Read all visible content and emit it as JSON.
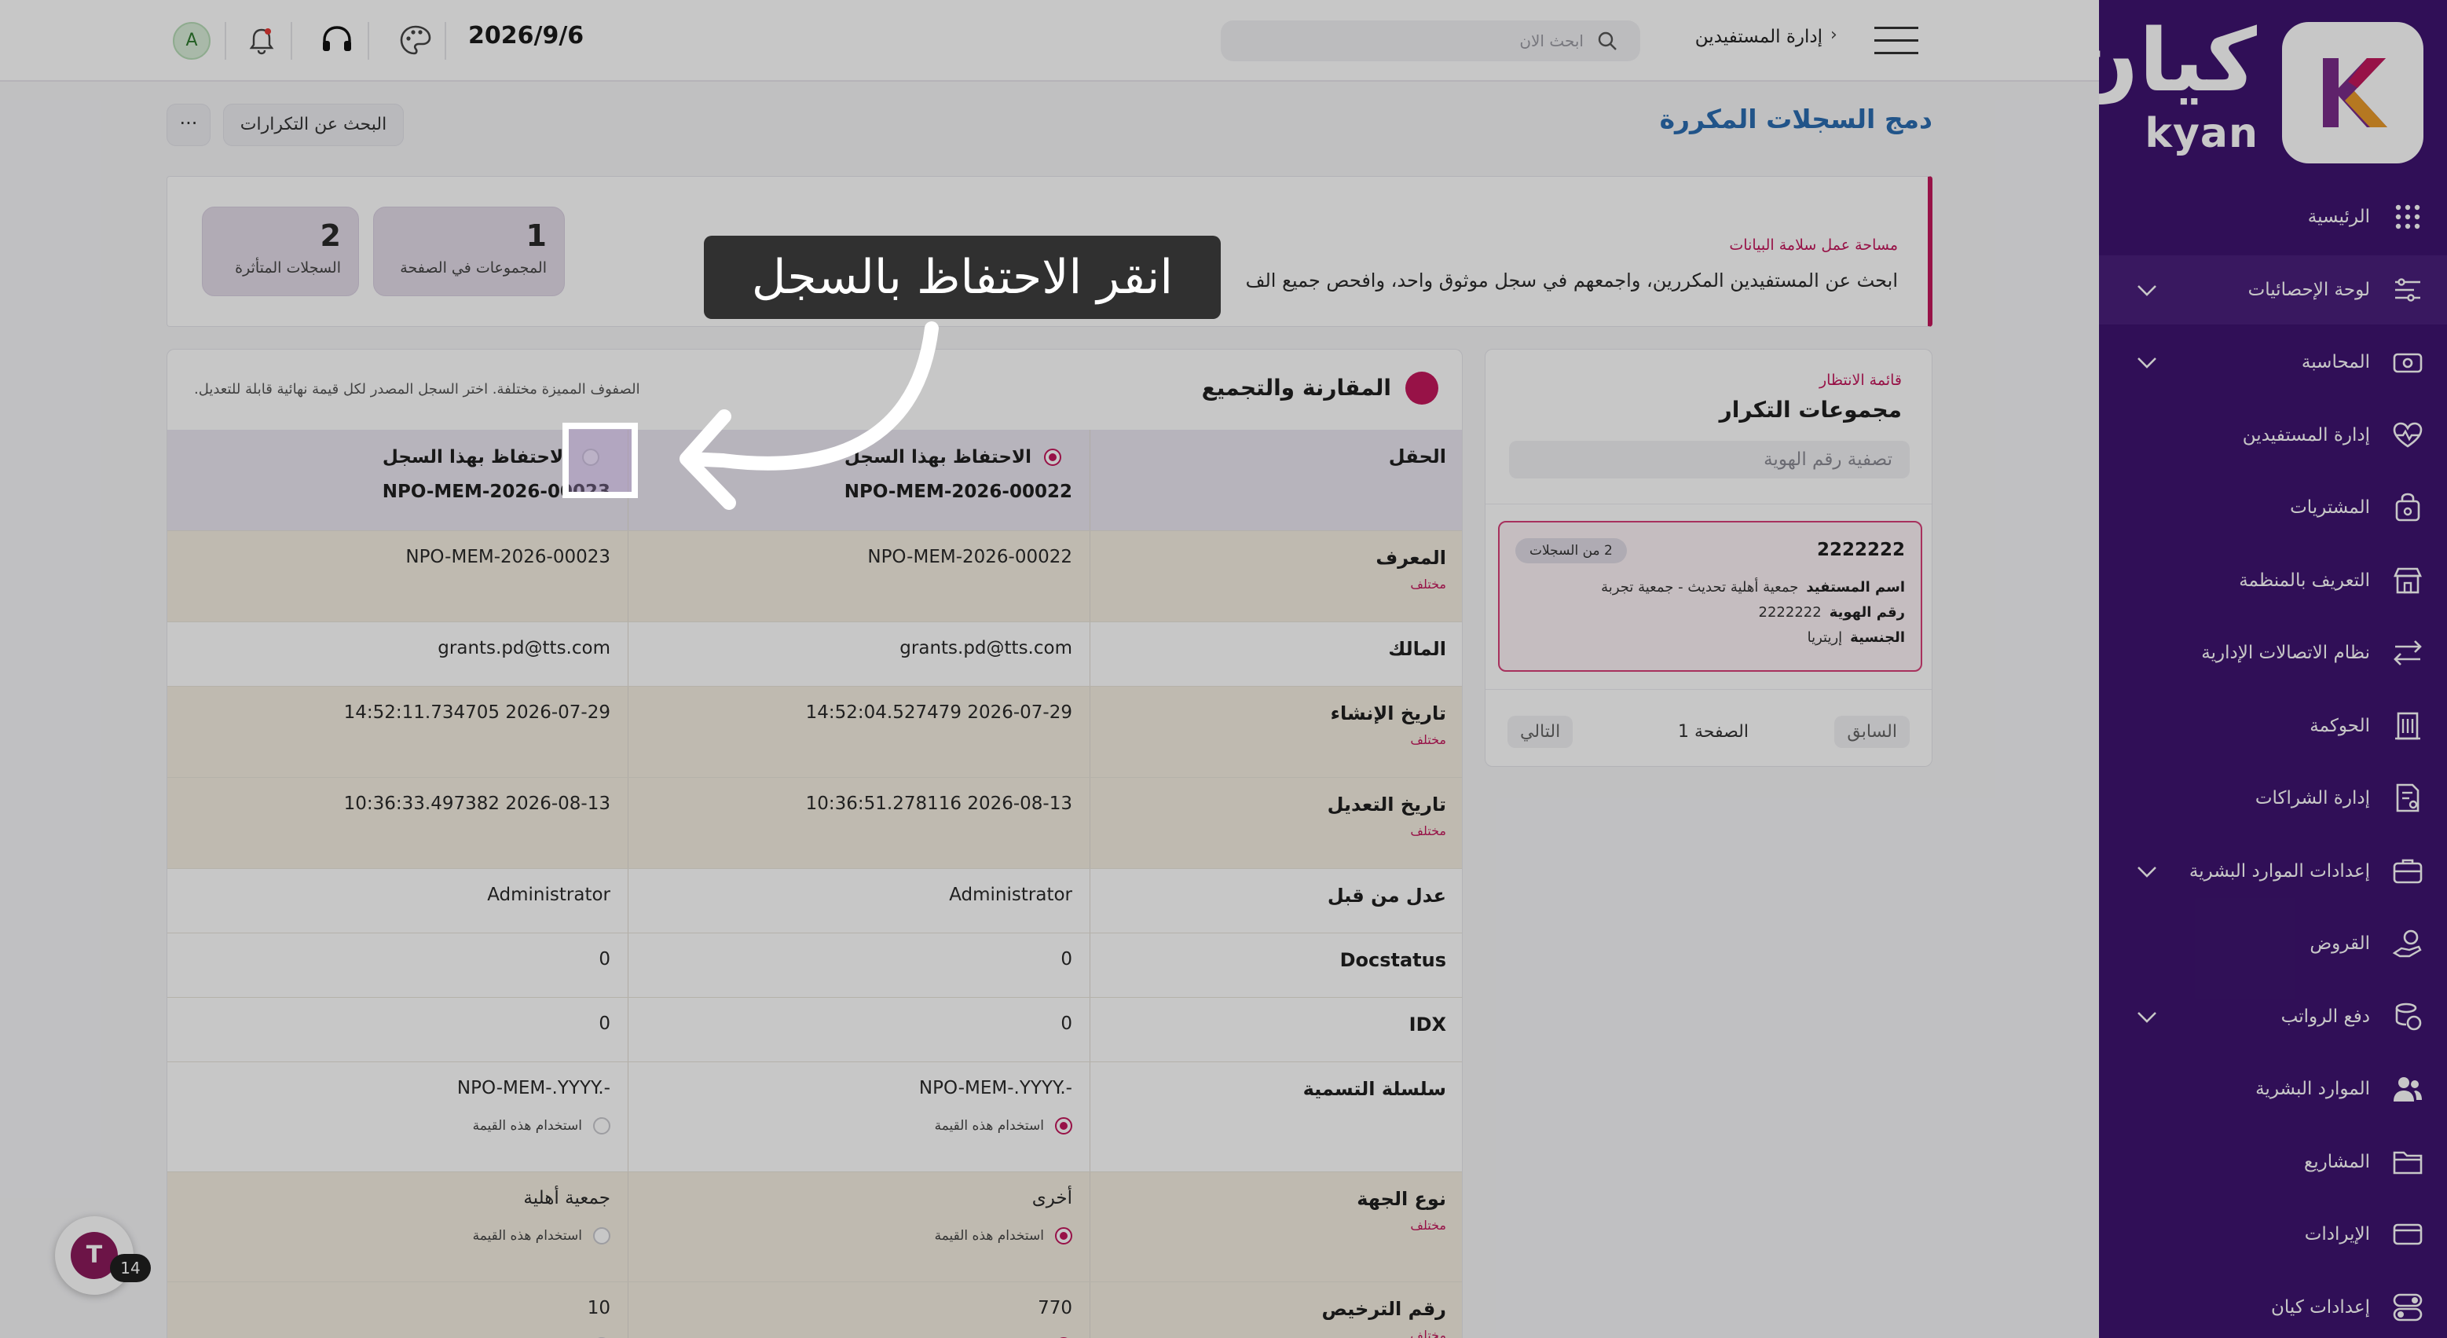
{
  "brand": {
    "arabic": "كيان",
    "latin": "kyan"
  },
  "sidebar": {
    "items": [
      {
        "label": "الرئيسية",
        "icon": "grid-icon",
        "chevron": false,
        "active": false
      },
      {
        "label": "لوحة الإحصائيات",
        "icon": "sliders-icon",
        "chevron": true,
        "active": true
      },
      {
        "label": "المحاسبة",
        "icon": "money-icon",
        "chevron": true,
        "active": false
      },
      {
        "label": "إدارة المستفيدين",
        "icon": "heart-pulse-icon",
        "chevron": false,
        "active": false
      },
      {
        "label": "المشتريات",
        "icon": "purchase-icon",
        "chevron": false,
        "active": false
      },
      {
        "label": "التعريف بالمنظمة",
        "icon": "store-icon",
        "chevron": false,
        "active": false
      },
      {
        "label": "نظام الاتصالات الإدارية",
        "icon": "swap-arrows-icon",
        "chevron": false,
        "active": false
      },
      {
        "label": "الحوكمة",
        "icon": "building-icon",
        "chevron": false,
        "active": false
      },
      {
        "label": "إدارة الشراكات",
        "icon": "document-user-icon",
        "chevron": false,
        "active": false
      },
      {
        "label": "إعدادات الموارد البشرية",
        "icon": "briefcase-icon",
        "chevron": true,
        "active": false
      },
      {
        "label": "القروض",
        "icon": "hand-money-icon",
        "chevron": false,
        "active": false
      },
      {
        "label": "دفع الرواتب",
        "icon": "coins-icon",
        "chevron": true,
        "active": false
      },
      {
        "label": "الموارد البشرية",
        "icon": "users-icon",
        "chevron": false,
        "active": false
      },
      {
        "label": "المشاريع",
        "icon": "folder-icon",
        "chevron": false,
        "active": false
      },
      {
        "label": "الإيرادات",
        "icon": "card-icon",
        "chevron": false,
        "active": false
      },
      {
        "label": "إعدادات كيان",
        "icon": "toggle-icon",
        "chevron": false,
        "active": false
      }
    ]
  },
  "topbar": {
    "breadcrumb": "إدارة المستفيدين",
    "search_placeholder": "ابحث الان",
    "date": "2026/9/6",
    "avatar_letter": "A"
  },
  "page": {
    "title": "دمج السجلات المكررة",
    "dup_search_button": "البحث عن التكرارات",
    "more_button": "···"
  },
  "hero": {
    "eyebrow": "مساحة عمل سلامة البيانات",
    "description": "ابحث عن المستفيدين المكررين، واجمعهم في سجل موثوق واحد، وافحص جميع الف",
    "stats": [
      {
        "value": "1",
        "label": "المجموعات في الصفحة"
      },
      {
        "value": "2",
        "label": "السجلات المتأثرة"
      }
    ]
  },
  "queue": {
    "eyebrow": "قائمة الانتظار",
    "title": "مجموعات التكرار",
    "filter_placeholder": "تصفية رقم الهوية",
    "card": {
      "id": "2222222",
      "badge": "2 من السجلات",
      "name_label": "اسم المستفيد",
      "name_value": "جمعية أهلية تحديث - جمعية تجربة",
      "idnum_label": "رقم الهوية",
      "idnum_value": "2222222",
      "nationality_label": "الجنسية",
      "nationality_value": "إريتريا"
    },
    "prev": "السابق",
    "page": "الصفحة 1",
    "next": "التالي"
  },
  "compare": {
    "title": "المقارنة والتجميع",
    "note": "الصفوف المميزة مختلفة. اختر السجل المصدر لكل قيمة نهائية قابلة للتعديل.",
    "field_header": "الحقل",
    "keep_label": "الاحتفاظ بهذا السجل",
    "record_a": "NPO-MEM-2026-00022",
    "record_b": "NPO-MEM-2026-00023",
    "diff_label": "مختلف",
    "use_value_label": "استخدام هذه القيمة",
    "rows": [
      {
        "field": "المعرف",
        "a": "NPO-MEM-2026-00022",
        "b": "NPO-MEM-2026-00023",
        "diff": true,
        "choice": false
      },
      {
        "field": "المالك",
        "a": "grants.pd@tts.com",
        "b": "grants.pd@tts.com",
        "diff": false,
        "choice": false
      },
      {
        "field": "تاريخ الإنشاء",
        "a": "14:52:04.527479 2026-07-29",
        "b": "14:52:11.734705 2026-07-29",
        "diff": true,
        "choice": false
      },
      {
        "field": "تاريخ التعديل",
        "a": "10:36:51.278116 2026-08-13",
        "b": "10:36:33.497382 2026-08-13",
        "diff": true,
        "choice": false
      },
      {
        "field": "عدل من قبل",
        "a": "Administrator",
        "b": "Administrator",
        "diff": false,
        "choice": false
      },
      {
        "field": "Docstatus",
        "a": "0",
        "b": "0",
        "diff": false,
        "choice": false
      },
      {
        "field": "IDX",
        "a": "0",
        "b": "0",
        "diff": false,
        "choice": false
      },
      {
        "field": "سلسلة التسمية",
        "a": "NPO-MEM-.YYYY.-",
        "b": "NPO-MEM-.YYYY.-",
        "diff": false,
        "choice": true
      },
      {
        "field": "نوع الجهة",
        "a": "أخرى",
        "b": "جمعية أهلية",
        "diff": true,
        "choice": true
      },
      {
        "field": "رقم الترخيص",
        "a": "770",
        "b": "10",
        "diff": true,
        "choice": true
      }
    ]
  },
  "overlay": {
    "tooltip": "انقر الاحتفاظ بالسجل"
  },
  "fab": {
    "glyph": "T",
    "badge": "14"
  },
  "colors": {
    "sidebar": "#3e1470",
    "accent": "#c2185b",
    "title_blue": "#2b6cb0",
    "diff_row": "#f5efe2",
    "header_row": "#ebe7f1"
  }
}
